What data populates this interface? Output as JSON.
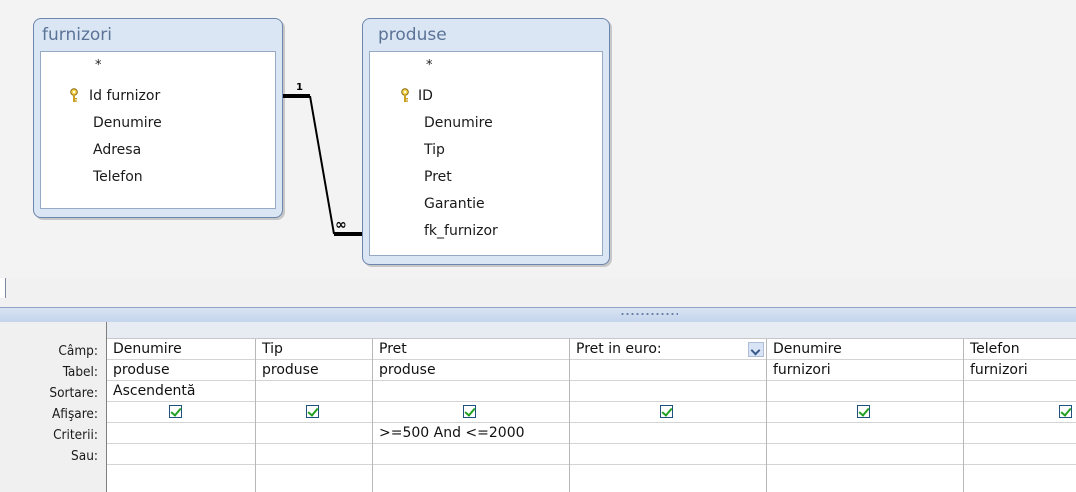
{
  "tables": [
    {
      "name": "furnizori",
      "fields": [
        "*",
        "Id furnizor",
        "Denumire",
        "Adresa",
        "Telefon"
      ],
      "primary_key": "Id furnizor"
    },
    {
      "name": "produse",
      "fields": [
        "*",
        "ID",
        "Denumire",
        "Tip",
        "Pret",
        "Garantie",
        "fk_furnizor"
      ],
      "primary_key": "ID"
    }
  ],
  "relationship": {
    "from": "furnizori.Id furnizor",
    "to": "produse.fk_furnizor",
    "one_label": "1",
    "many_label": "∞"
  },
  "row_labels": [
    "Câmp:",
    "Tabel:",
    "Sortare:",
    "Afişare:",
    "Criterii:",
    "Sau:"
  ],
  "columns": [
    {
      "field": "Denumire",
      "table": "produse",
      "sort": "Ascendentă",
      "show": true,
      "criteria": "",
      "or": ""
    },
    {
      "field": "Tip",
      "table": "produse",
      "sort": "",
      "show": true,
      "criteria": "",
      "or": ""
    },
    {
      "field": "Pret",
      "table": "produse",
      "sort": "",
      "show": true,
      "criteria": ">=500 And <=2000",
      "or": ""
    },
    {
      "field": "Pret in euro:",
      "table": "",
      "sort": "",
      "show": true,
      "criteria": "",
      "or": "",
      "has_dropdown": true
    },
    {
      "field": "Denumire",
      "table": "furnizori",
      "sort": "",
      "show": true,
      "criteria": "",
      "or": ""
    },
    {
      "field": "Telefon",
      "table": "furnizori",
      "sort": "",
      "show": true,
      "criteria": "",
      "or": ""
    }
  ],
  "icons": {
    "key": "key-icon",
    "checkbox": "checkbox-checked-icon",
    "dropdown": "chevron-down-icon"
  },
  "colors": {
    "table_header": "#dbe6f5",
    "table_border": "#6c86ad",
    "title_text": "#5b7397",
    "check": "#21a121"
  }
}
